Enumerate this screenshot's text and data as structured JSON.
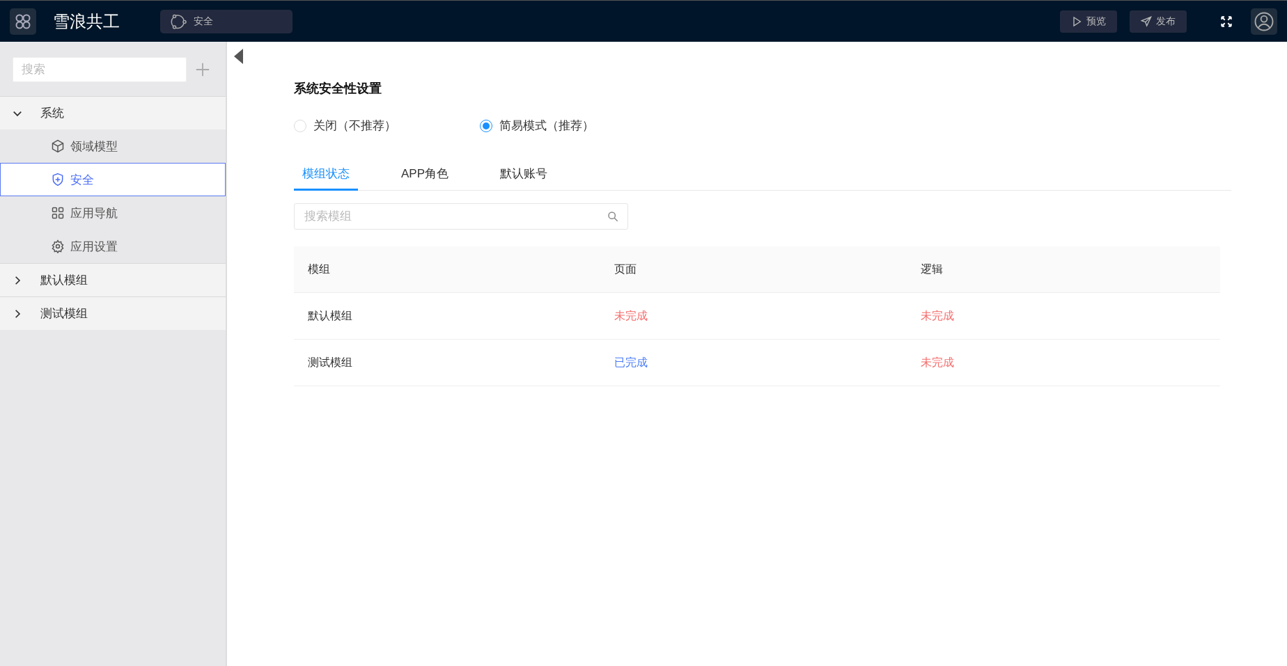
{
  "header": {
    "app_name": "雪浪共工",
    "breadcrumb": "安全",
    "buttons": [
      {
        "label": "预览"
      },
      {
        "label": "发布"
      }
    ]
  },
  "sidebar": {
    "search": {
      "placeholder": "搜索"
    },
    "tree": [
      {
        "label": "系统",
        "expanded": true,
        "children": [
          {
            "label": "领域模型",
            "selected": false
          },
          {
            "label": "安全",
            "selected": true
          },
          {
            "label": "应用导航",
            "selected": false
          },
          {
            "label": "应用设置",
            "selected": false
          }
        ]
      },
      {
        "label": "默认模组",
        "expanded": false
      },
      {
        "label": "测试模组",
        "expanded": false
      }
    ]
  },
  "content": {
    "title": "系统安全性设置",
    "radios": [
      {
        "label": "关闭（不推荐）",
        "selected": false
      },
      {
        "label": "简易模式（推荐）",
        "selected": true
      }
    ],
    "tabs": [
      {
        "label": "模组状态",
        "selected": true
      },
      {
        "label": "APP角色",
        "selected": false
      },
      {
        "label": "默认账号",
        "selected": false
      }
    ],
    "search": {
      "placeholder": "搜索模组"
    },
    "table": {
      "columns": [
        "模组",
        "页面",
        "逻辑"
      ],
      "rows": [
        {
          "module": "默认模组",
          "page": {
            "text": "未完成",
            "kind": "pending"
          },
          "logic": {
            "text": "未完成",
            "kind": "pending"
          }
        },
        {
          "module": "测试模组",
          "page": {
            "text": "已完成",
            "kind": "done"
          },
          "logic": {
            "text": "未完成",
            "kind": "pending"
          }
        }
      ]
    }
  }
}
